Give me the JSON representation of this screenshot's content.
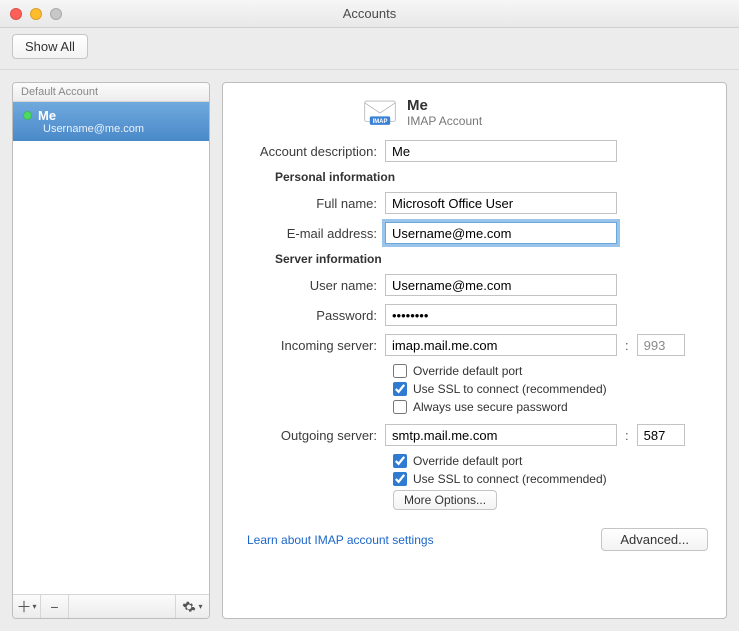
{
  "window": {
    "title": "Accounts"
  },
  "toolbar": {
    "show_all": "Show All"
  },
  "sidebar": {
    "header": "Default Account",
    "account": {
      "name": "Me",
      "email": "Username@me.com"
    }
  },
  "detail": {
    "header_title": "Me",
    "header_subtitle": "IMAP Account",
    "labels": {
      "desc": "Account description:",
      "full_name": "Full name:",
      "email": "E-mail address:",
      "username": "User name:",
      "password": "Password:",
      "incoming": "Incoming server:",
      "outgoing": "Outgoing server:"
    },
    "sections": {
      "personal": "Personal information",
      "server": "Server information"
    },
    "values": {
      "desc": "Me",
      "full_name": "Microsoft Office User",
      "email": "Username@me.com",
      "username": "Username@me.com",
      "password": "••••••••",
      "incoming_server": "imap.mail.me.com",
      "incoming_port": "993",
      "outgoing_server": "smtp.mail.me.com",
      "outgoing_port": "587"
    },
    "checkboxes": {
      "incoming_override": {
        "label": "Override default port",
        "checked": false
      },
      "incoming_ssl": {
        "label": "Use SSL to connect (recommended)",
        "checked": true
      },
      "incoming_secure_pw": {
        "label": "Always use secure password",
        "checked": false
      },
      "outgoing_override": {
        "label": "Override default port",
        "checked": true
      },
      "outgoing_ssl": {
        "label": "Use SSL to connect (recommended)",
        "checked": true
      }
    },
    "buttons": {
      "more_options": "More Options...",
      "advanced": "Advanced..."
    },
    "link": "Learn about IMAP account settings"
  }
}
